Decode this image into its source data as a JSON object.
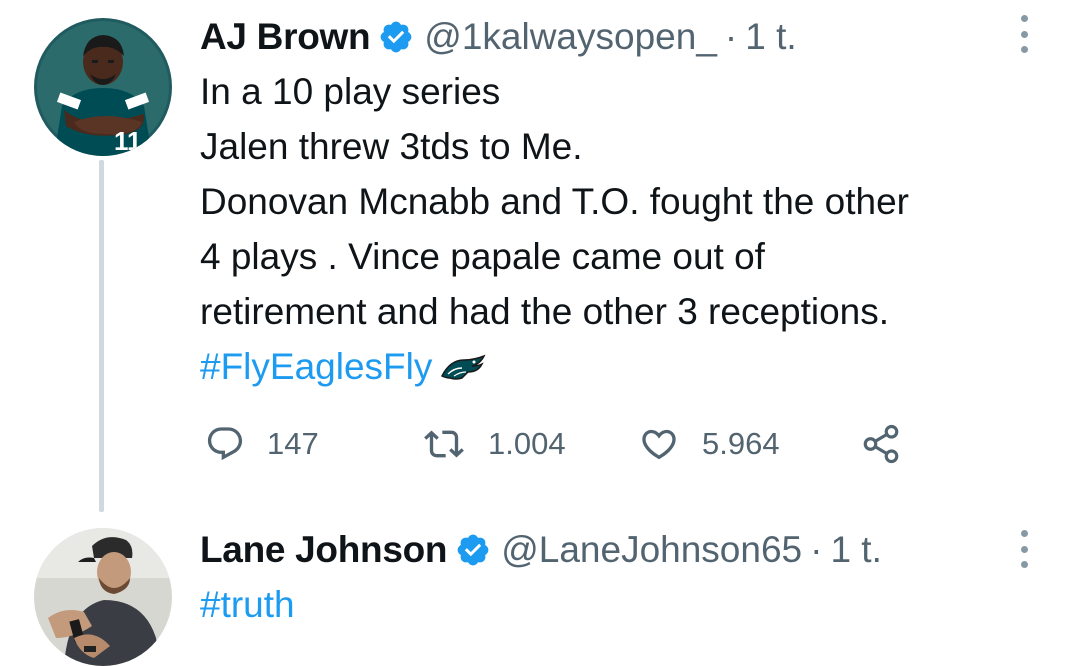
{
  "tweets": [
    {
      "name": "AJ Brown",
      "handle": "@1kalwaysopen_",
      "separator": "·",
      "time": "1 t.",
      "lines": [
        "In a 10 play series",
        "Jalen threw 3tds to Me.",
        "Donovan Mcnabb and T.O. fought the other",
        "4 plays . Vince papale came out of",
        "retirement and had the other 3 receptions."
      ],
      "hashtag": "#FlyEaglesFly",
      "replies": "147",
      "retweets": "1.004",
      "likes": "5.964"
    },
    {
      "name": "Lane Johnson",
      "handle": "@LaneJohnson65",
      "separator": "·",
      "time": "1 t.",
      "hashtag": "#truth"
    }
  ],
  "colors": {
    "link": "#1d9bf0",
    "secondary": "#536471",
    "verified": "#1d9bf0",
    "eagles_green": "#004c54"
  },
  "icons": [
    "verified-badge-icon",
    "more-options-icon",
    "reply-icon",
    "retweet-icon",
    "like-icon",
    "share-icon",
    "eagle-emoji-icon"
  ]
}
